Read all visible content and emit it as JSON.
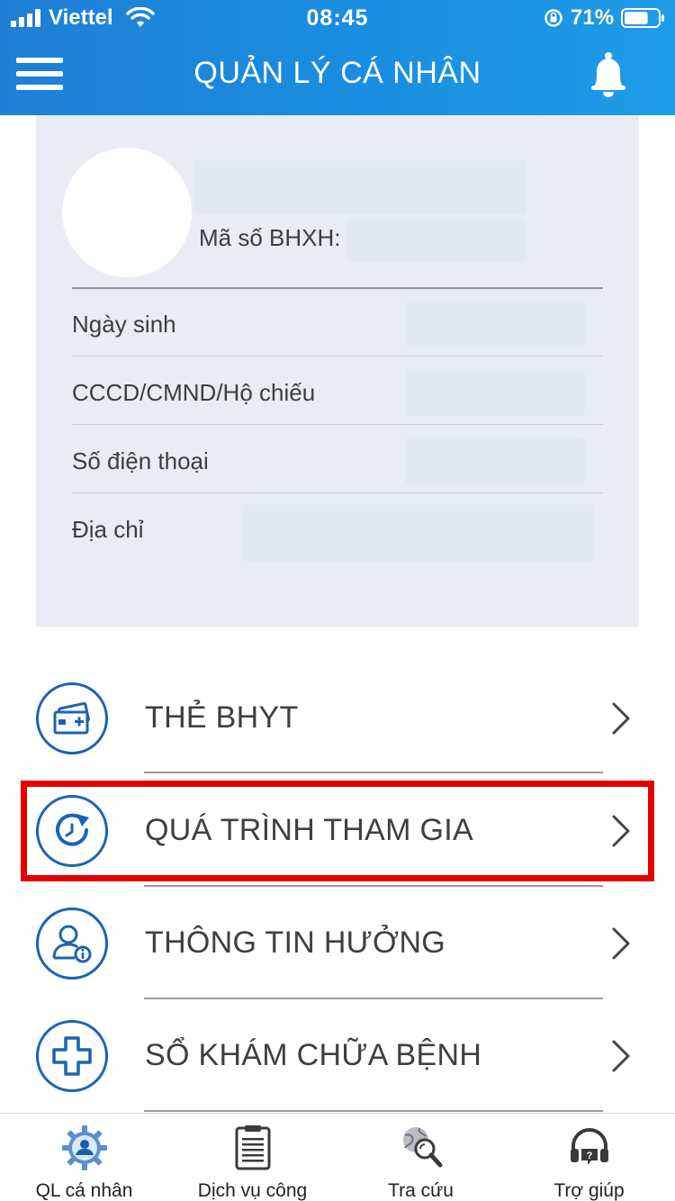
{
  "status_bar": {
    "carrier": "Viettel",
    "time": "08:45",
    "battery_percent": "71%",
    "battery_level": 0.71,
    "icons": [
      "signal-icon",
      "wifi-icon",
      "rotation-lock-icon",
      "battery-icon"
    ]
  },
  "header": {
    "title": "QUẢN LÝ CÁ NHÂN",
    "menu_icon": "hamburger-menu-icon",
    "notification_icon": "bell-icon"
  },
  "profile": {
    "bhxh_label": "Mã số BHXH:",
    "fields": [
      {
        "label": "Ngày sinh"
      },
      {
        "label": "CCCD/CMND/Hộ chiếu"
      },
      {
        "label": "Số điện thoại"
      },
      {
        "label": "Địa chỉ"
      }
    ]
  },
  "menu": {
    "items": [
      {
        "label": "THẺ BHYT",
        "icon": "health-card-icon"
      },
      {
        "label": "QUÁ TRÌNH THAM GIA",
        "icon": "history-clock-icon",
        "highlighted": true
      },
      {
        "label": "THÔNG TIN HƯỞNG",
        "icon": "user-info-icon"
      },
      {
        "label": "SỔ KHÁM CHỮA BỆNH",
        "icon": "medical-cross-icon"
      }
    ]
  },
  "tabbar": {
    "items": [
      {
        "label": "QL cá nhân",
        "icon": "personal-gear-icon",
        "active": true
      },
      {
        "label": "Dịch vụ công",
        "icon": "clipboard-icon"
      },
      {
        "label": "Tra cứu",
        "icon": "globe-search-icon"
      },
      {
        "label": "Trợ giúp",
        "icon": "headset-help-icon"
      }
    ]
  },
  "colors": {
    "header_start": "#1f7fd6",
    "header_end": "#1e9ce8",
    "icon_blue": "#1b63b3",
    "highlight_red": "#e50000",
    "card_bg": "#e9edf3"
  }
}
